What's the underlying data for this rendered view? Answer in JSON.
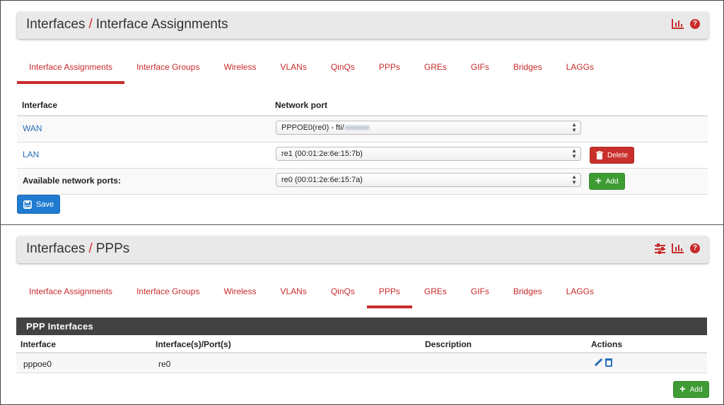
{
  "panel1": {
    "crumb_parent": "Interfaces",
    "crumb_slash": "/",
    "crumb_current": "Interface Assignments",
    "tabs": [
      "Interface Assignments",
      "Interface Groups",
      "Wireless",
      "VLANs",
      "QinQs",
      "PPPs",
      "GREs",
      "GIFs",
      "Bridges",
      "LAGGs"
    ],
    "active_tab": "Interface Assignments",
    "table": {
      "col_interface": "Interface",
      "col_network_port": "Network port",
      "rows": [
        {
          "name": "WAN",
          "port": "PPPOE0(re0) - fti/"
        },
        {
          "name": "LAN",
          "port": "re1 (00:01:2e:6e:15:7b)",
          "action": "Delete"
        },
        {
          "name": "Available network ports:",
          "port": "re0 (00:01:2e:6e:15:7a)",
          "action": "Add"
        }
      ]
    },
    "save_label": "Save"
  },
  "panel2": {
    "crumb_parent": "Interfaces",
    "crumb_slash": "/",
    "crumb_current": "PPPs",
    "tabs": [
      "Interface Assignments",
      "Interface Groups",
      "Wireless",
      "VLANs",
      "QinQs",
      "PPPs",
      "GREs",
      "GIFs",
      "Bridges",
      "LAGGs"
    ],
    "active_tab": "PPPs",
    "table": {
      "title": "PPP Interfaces",
      "col_interface": "Interface",
      "col_ports": "Interface(s)/Port(s)",
      "col_description": "Description",
      "col_actions": "Actions",
      "rows": [
        {
          "interface": "pppoe0",
          "ports": "re0",
          "description": ""
        }
      ]
    },
    "add_label": "Add"
  },
  "colors": {
    "accent_red": "#c92a2a",
    "link_blue": "#2a6db5",
    "delete_red": "#c9302c",
    "add_green": "#3f9c35",
    "save_blue": "#1f7bcf",
    "table_bar": "#424242"
  },
  "icons": [
    "chart-icon",
    "help-icon",
    "sliders-icon",
    "trash-icon",
    "plus-icon",
    "save-icon",
    "pencil-icon"
  ]
}
